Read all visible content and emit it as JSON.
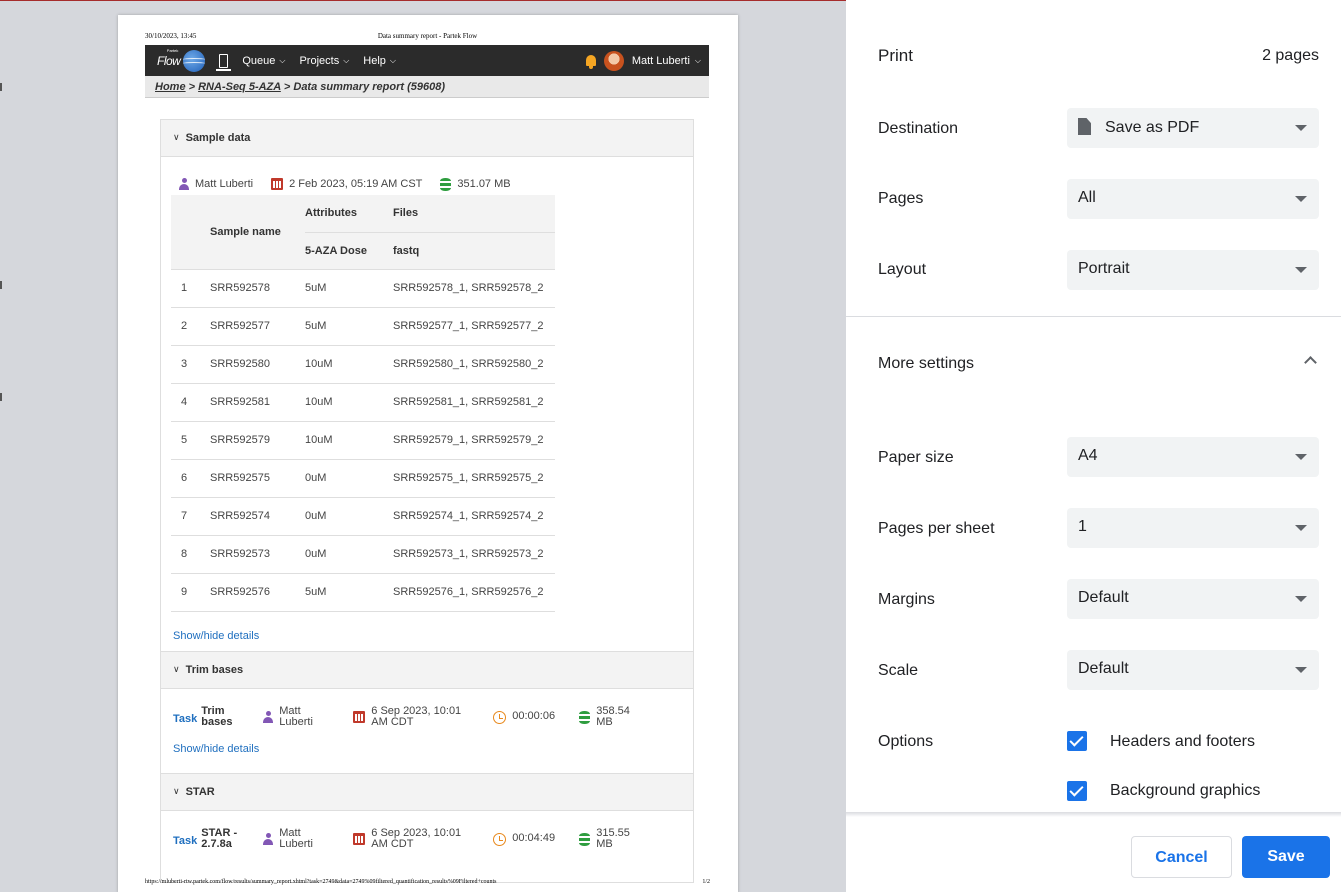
{
  "preview": {
    "header": {
      "datetime": "30/10/2023, 13:45",
      "title": "Data summary report - Partek Flow"
    },
    "footer": {
      "url": "https://mluberti-rtw.partek.com/flow/results/summary_report.xhtml?task=2749&data=2749%09filtered_quantification_results%09Filtered+counts",
      "page": "1/2"
    },
    "navbar": {
      "logo_small": "Partek",
      "logo": "Flow",
      "queue": "Queue",
      "projects": "Projects",
      "help": "Help",
      "user": "Matt Luberti"
    },
    "breadcrumb": {
      "home": "Home",
      "sep": " > ",
      "project": "RNA-Seq 5-AZA",
      "current": "Data summary report (59608)"
    },
    "sample_data": {
      "title": "Sample data",
      "user": "Matt Luberti",
      "date": "2 Feb 2023, 05:19 AM CST",
      "size": "351.07 MB",
      "columns": {
        "sample_name": "Sample name",
        "attributes": "Attributes",
        "files": "Files",
        "dose": "5-AZA Dose",
        "fastq": "fastq"
      },
      "rows": [
        {
          "n": "1",
          "name": "SRR592578",
          "dose": "5uM",
          "files": "SRR592578_1, SRR592578_2"
        },
        {
          "n": "2",
          "name": "SRR592577",
          "dose": "5uM",
          "files": "SRR592577_1, SRR592577_2"
        },
        {
          "n": "3",
          "name": "SRR592580",
          "dose": "10uM",
          "files": "SRR592580_1, SRR592580_2"
        },
        {
          "n": "4",
          "name": "SRR592581",
          "dose": "10uM",
          "files": "SRR592581_1, SRR592581_2"
        },
        {
          "n": "5",
          "name": "SRR592579",
          "dose": "10uM",
          "files": "SRR592579_1, SRR592579_2"
        },
        {
          "n": "6",
          "name": "SRR592575",
          "dose": "0uM",
          "files": "SRR592575_1, SRR592575_2"
        },
        {
          "n": "7",
          "name": "SRR592574",
          "dose": "0uM",
          "files": "SRR592574_1, SRR592574_2"
        },
        {
          "n": "8",
          "name": "SRR592573",
          "dose": "0uM",
          "files": "SRR592573_1, SRR592573_2"
        },
        {
          "n": "9",
          "name": "SRR592576",
          "dose": "5uM",
          "files": "SRR592576_1, SRR592576_2"
        }
      ],
      "toggle": "Show/hide details"
    },
    "trim": {
      "title": "Trim bases",
      "task_label": "Task",
      "task_name_1": "Trim",
      "task_name_2": "bases",
      "user_1": "Matt",
      "user_2": "Luberti",
      "date_1": "6 Sep 2023, 10:01",
      "date_2": "AM CDT",
      "duration": "00:00:06",
      "size_1": "358.54",
      "size_2": "MB",
      "toggle": "Show/hide details"
    },
    "star": {
      "title": "STAR",
      "task_label": "Task",
      "task_name_1": "STAR -",
      "task_name_2": "2.7.8a",
      "user_1": "Matt",
      "user_2": "Luberti",
      "date_1": "6 Sep 2023, 10:01",
      "date_2": "AM CDT",
      "duration": "00:04:49",
      "size_1": "315.55",
      "size_2": "MB"
    }
  },
  "panel": {
    "title": "Print",
    "pages_count": "2 pages",
    "destination": {
      "label": "Destination",
      "value": "Save as PDF"
    },
    "pages": {
      "label": "Pages",
      "value": "All"
    },
    "layout": {
      "label": "Layout",
      "value": "Portrait"
    },
    "more_settings": "More settings",
    "paper_size": {
      "label": "Paper size",
      "value": "A4"
    },
    "pages_per_sheet": {
      "label": "Pages per sheet",
      "value": "1"
    },
    "margins": {
      "label": "Margins",
      "value": "Default"
    },
    "scale": {
      "label": "Scale",
      "value": "Default"
    },
    "options": {
      "label": "Options",
      "headers_footers": "Headers and footers",
      "background_graphics": "Background graphics"
    },
    "cancel": "Cancel",
    "save": "Save",
    "accent_color": "#1a73e8"
  }
}
